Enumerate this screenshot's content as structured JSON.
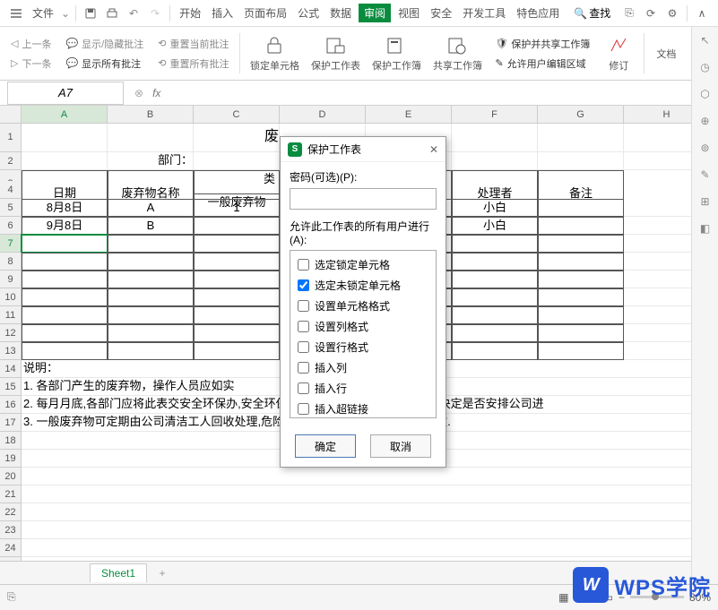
{
  "menu": {
    "file": "文件",
    "items": [
      "开始",
      "插入",
      "页面布局",
      "公式",
      "数据",
      "审阅",
      "视图",
      "安全",
      "开发工具",
      "特色应用"
    ],
    "active_index": 5,
    "search": "查找"
  },
  "ribbon": {
    "prev": "上一条",
    "next": "下一条",
    "show_hide": "显示/隐藏批注",
    "show_all": "显示所有批注",
    "reset_current": "重置当前批注",
    "reset_all": "重置所有批注",
    "lock_cell": "锁定单元格",
    "protect_sheet": "保护工作表",
    "protect_book": "保护工作簿",
    "share_book": "共享工作簿",
    "protect_share": "保护并共享工作簿",
    "allow_edit": "允许用户编辑区域",
    "track": "修订",
    "doc": "文档"
  },
  "formula": {
    "name_box": "A7",
    "fx": "fx"
  },
  "columns": [
    "A",
    "B",
    "C",
    "D",
    "E",
    "F",
    "G",
    "H"
  ],
  "active_col": 0,
  "active_row": 7,
  "grid": {
    "r1_c": "废",
    "r2_b": "部门：",
    "r3": {
      "a": "日期",
      "b": "废弃物名称",
      "c": "类",
      "f": "处理者",
      "g": "备注"
    },
    "r4_c": "一般废弃物",
    "r5": {
      "a": "8月8日",
      "b": "A",
      "c": "1",
      "f": "小白"
    },
    "r6": {
      "a": "9月8日",
      "b": "B",
      "f": "小白"
    },
    "r14": "说明：",
    "r15": "1.        各部门产生的废弃物，操作人员应如实",
    "r16": "2.        每月月底,各部门应将此表交安全环保办,安全环保办人员根据废弃物产生的数量决定是否安排公司进",
    "r17": "3.        一般废弃物可定期由公司清洁工人回收处理,危险废弃物须由安全环保办统一回收."
  },
  "dialog": {
    "title": "保护工作表",
    "pwd_label": "密码(可选)(P):",
    "perm_label": "允许此工作表的所有用户进行(A):",
    "perms": [
      {
        "label": "选定锁定单元格",
        "checked": false
      },
      {
        "label": "选定未锁定单元格",
        "checked": true
      },
      {
        "label": "设置单元格格式",
        "checked": false
      },
      {
        "label": "设置列格式",
        "checked": false
      },
      {
        "label": "设置行格式",
        "checked": false
      },
      {
        "label": "插入列",
        "checked": false
      },
      {
        "label": "插入行",
        "checked": false
      },
      {
        "label": "插入超链接",
        "checked": false
      }
    ],
    "ok": "确定",
    "cancel": "取消"
  },
  "sheet_tab": "Sheet1",
  "zoom": "80%",
  "watermark": "WPS学院"
}
